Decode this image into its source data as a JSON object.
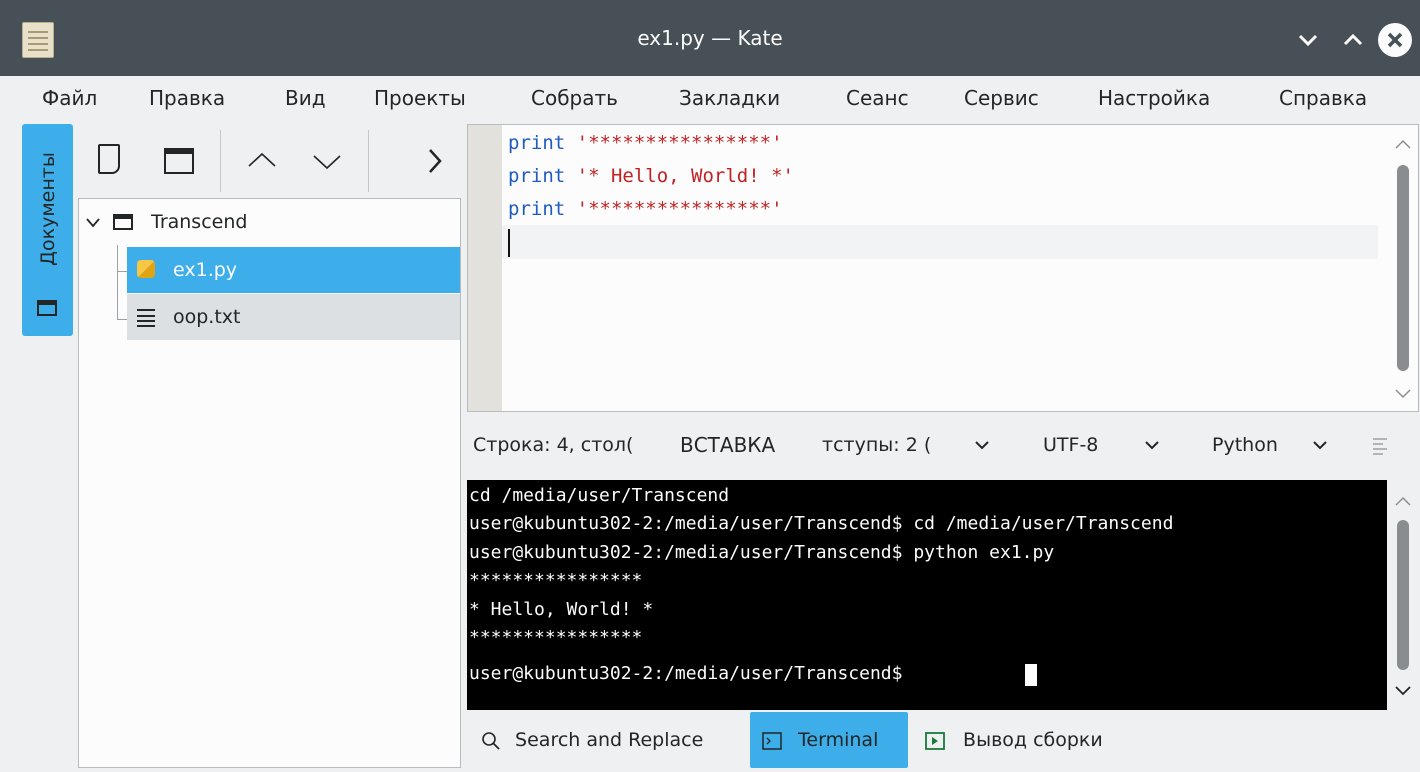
{
  "window": {
    "title": "ex1.py — Kate",
    "minimize_glyph": "⌄",
    "maximize_glyph": "⌃",
    "close_glyph": "✕"
  },
  "menu": [
    "Файл",
    "Правка",
    "Вид",
    "Проекты",
    "Собрать",
    "Закладки",
    "Сеанс",
    "Сервис",
    "Настройка",
    "Справка"
  ],
  "sidebar": {
    "tab_label": "Документы",
    "tree": {
      "folder": "Transcend",
      "files": [
        {
          "name": "ex1.py",
          "icon": "python-file-icon",
          "selected": true
        },
        {
          "name": "oop.txt",
          "icon": "text-file-icon",
          "selected": false
        }
      ]
    }
  },
  "toolbar": {
    "up": "︿",
    "down": "﹀",
    "more": "›"
  },
  "editor": {
    "lines": [
      {
        "keyword": "print",
        "string": "'****************'"
      },
      {
        "keyword": "print",
        "string": "'* Hello, World! *'"
      },
      {
        "keyword": "print",
        "string": "'****************'"
      }
    ],
    "current_line": 4
  },
  "statusbar": {
    "position": "Строка: 4, стол(",
    "mode": "ВСТАВКА",
    "indent": "тступы: 2 (",
    "encoding": "UTF-8",
    "language": "Python"
  },
  "terminal": {
    "lines": [
      "cd /media/user/Transcend",
      "user@kubuntu302-2:/media/user/Transcend$ cd /media/user/Transcend",
      "user@kubuntu302-2:/media/user/Transcend$ python ex1.py",
      "****************",
      "* Hello, World! *",
      "****************",
      "user@kubuntu302-2:/media/user/Transcend$ "
    ]
  },
  "bottom_tabs": [
    {
      "label": "Search and Replace",
      "icon": "search-icon",
      "active": false
    },
    {
      "label": "Terminal",
      "icon": "terminal-icon",
      "active": true
    },
    {
      "label": "Вывод сборки",
      "icon": "build-output-icon",
      "active": false
    }
  ],
  "colors": {
    "accent": "#3daee9",
    "titlebar": "#475057",
    "keyword": "#1f5cbf",
    "string": "#bf2323"
  }
}
